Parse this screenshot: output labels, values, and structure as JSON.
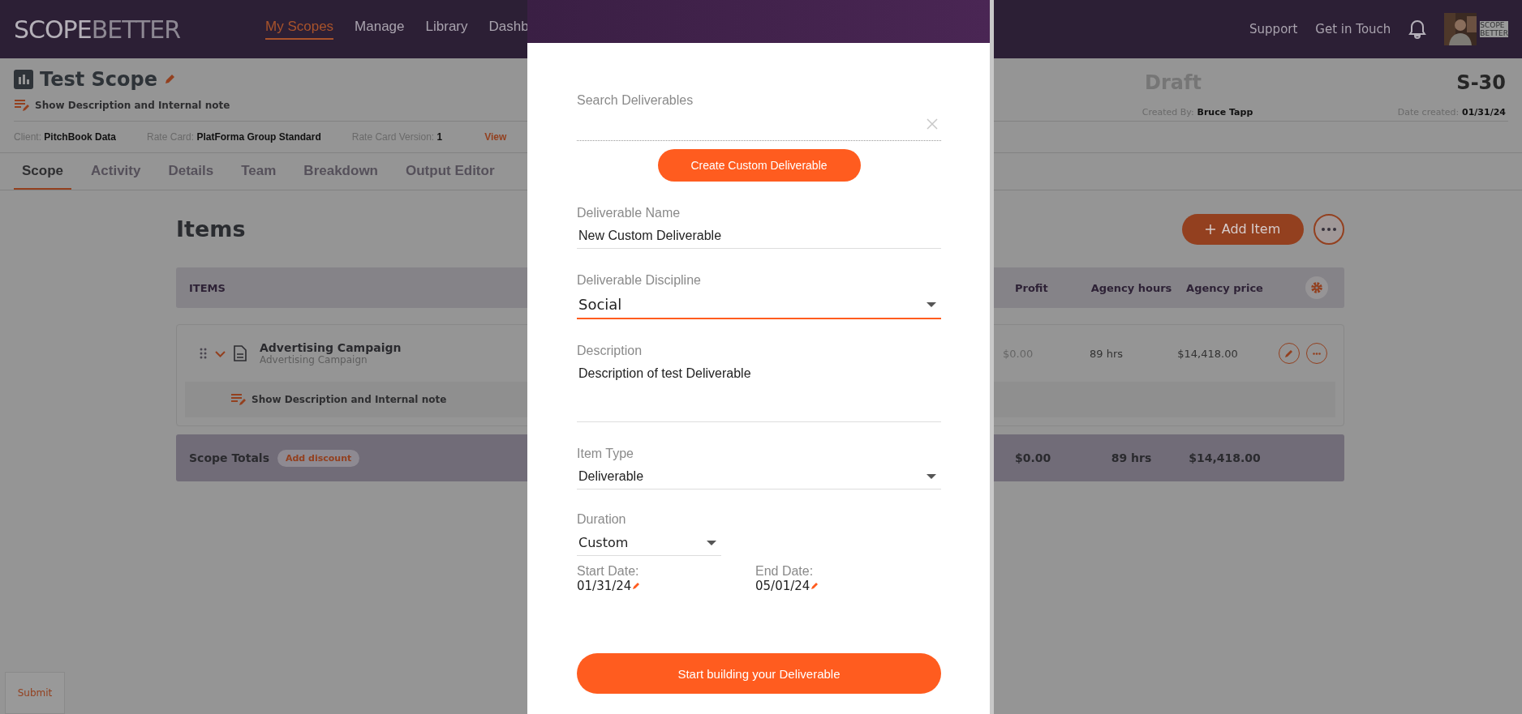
{
  "header": {
    "logo": [
      "SCOPE",
      "BETTER"
    ],
    "nav": [
      {
        "label": "My Scopes",
        "selected": true
      },
      {
        "label": "Manage",
        "selected": false
      },
      {
        "label": "Library",
        "selected": false
      },
      {
        "label": "Dashb",
        "selected": false
      }
    ],
    "links": [
      "Support",
      "Get in Touch"
    ],
    "avatar": {
      "kind": "picture"
    },
    "avatar_logo": [
      "SCOPE",
      "BETTER"
    ]
  },
  "scope": {
    "title": "Test Scope",
    "description_toggle": "Show Description and Internal note",
    "status": "Draft",
    "number": "S-30",
    "created_by": {
      "label": "Created By:",
      "value": "Bruce Tapp"
    },
    "date_created": {
      "label": "Date created:",
      "value": "01/31/24"
    },
    "info": [
      {
        "label": "Client:",
        "value": "PitchBook Data"
      },
      {
        "label": "Rate Card:",
        "value": "PlatForma Group Standard"
      },
      {
        "label": "Rate Card Version:",
        "value": "1"
      }
    ],
    "info_link": "View"
  },
  "tabs": [
    {
      "label": "Scope",
      "selected": true
    },
    {
      "label": "Activity",
      "selected": false
    },
    {
      "label": "Details",
      "selected": false
    },
    {
      "label": "Team",
      "selected": false
    },
    {
      "label": "Breakdown",
      "selected": false
    },
    {
      "label": "Output Editor",
      "selected": false
    }
  ],
  "items": {
    "title": "Items",
    "add_button": "Add Item",
    "columns": [
      "ITEMS",
      "Profit",
      "Agency hours",
      "Agency price"
    ],
    "rows": [
      {
        "name": "Advertising Campaign",
        "subtitle": "Advertising Campaign",
        "expanded": true,
        "profit": "$0.00",
        "hours": "89 hrs",
        "price": "$14,418.00",
        "description_toggle": "Show Description and Internal note"
      }
    ],
    "totals": {
      "label": "Scope Totals",
      "discount_button": "Add discount",
      "profit": "$0.00",
      "hours": "89 hrs",
      "price": "$14,418.00"
    }
  },
  "submit_button": "Submit",
  "modal": {
    "search_label": "Search Deliverables",
    "create_button": "Create Custom Deliverable",
    "fields": [
      {
        "kind": "text",
        "label": "Deliverable Name",
        "value": "New Custom Deliverable"
      },
      {
        "kind": "select",
        "label": "Deliverable Discipline",
        "value": "Social",
        "focused": true
      },
      {
        "kind": "textarea",
        "label": "Description",
        "value": "Description of test Deliverable"
      },
      {
        "kind": "select",
        "label": "Item Type",
        "value": "Deliverable",
        "focused": false
      }
    ],
    "duration": {
      "label": "Duration",
      "value": "Custom"
    },
    "dates": [
      {
        "label": "Start Date:",
        "value": "01/31/24"
      },
      {
        "label": "End Date:",
        "value": "05/01/24"
      }
    ],
    "submit_button": "Start building your Deliverable"
  }
}
